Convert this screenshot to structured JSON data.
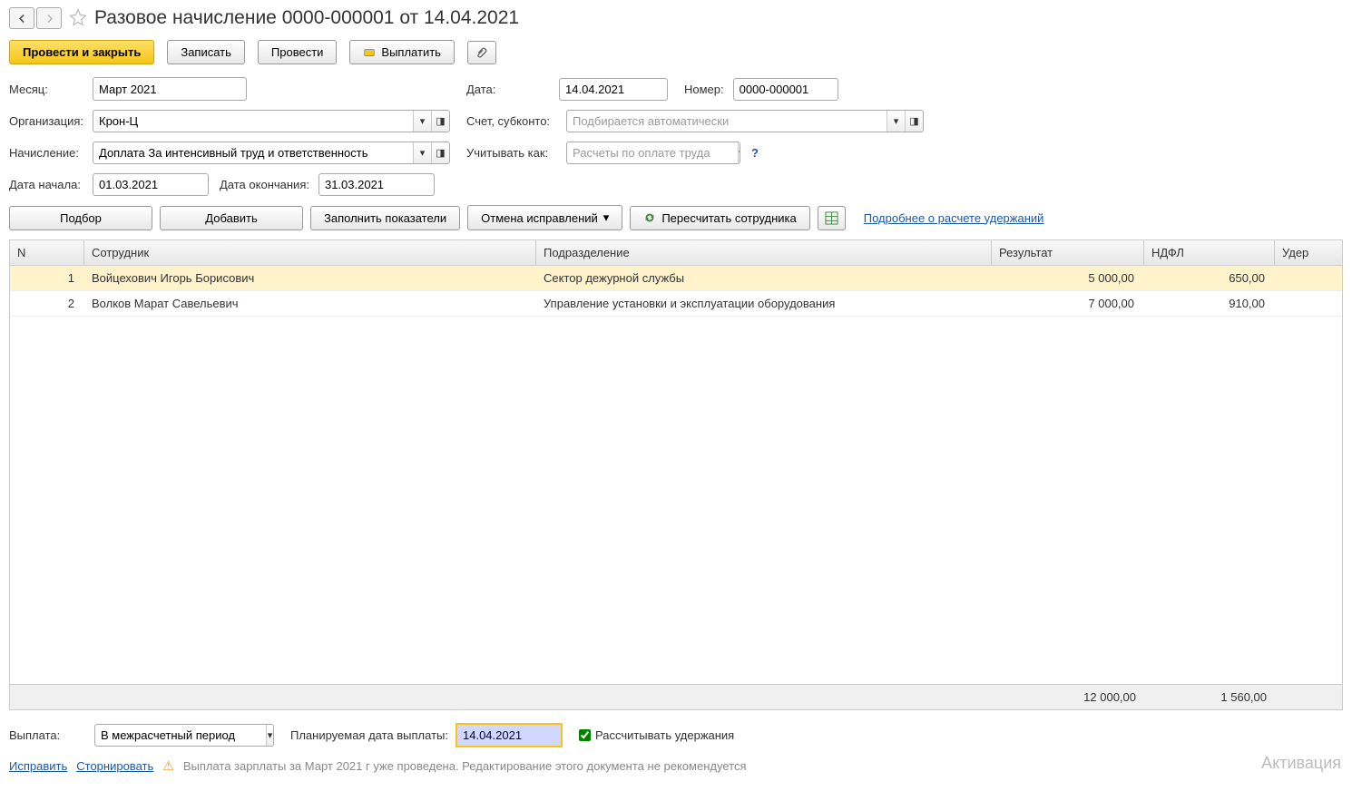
{
  "header": {
    "title": "Разовое начисление 0000-000001 от 14.04.2021"
  },
  "toolbar": {
    "post_and_close": "Провести и закрыть",
    "save": "Записать",
    "post": "Провести",
    "pay": "Выплатить"
  },
  "form": {
    "month_label": "Месяц:",
    "month_value": "Март 2021",
    "date_label": "Дата:",
    "date_value": "14.04.2021",
    "number_label": "Номер:",
    "number_value": "0000-000001",
    "org_label": "Организация:",
    "org_value": "Крон-Ц",
    "account_label": "Счет, субконто:",
    "account_placeholder": "Подбирается автоматически",
    "accrual_label": "Начисление:",
    "accrual_value": "Доплата За интенсивный труд и ответственность",
    "consider_label": "Учитывать как:",
    "consider_placeholder": "Расчеты по оплате труда",
    "start_label": "Дата начала:",
    "start_value": "01.03.2021",
    "end_label": "Дата окончания:",
    "end_value": "31.03.2021"
  },
  "toolbar2": {
    "select": "Подбор",
    "add": "Добавить",
    "fill": "Заполнить показатели",
    "cancel": "Отмена исправлений",
    "recalc": "Пересчитать сотрудника",
    "details_link": "Подробнее о расчете удержаний"
  },
  "table": {
    "columns": {
      "n": "N",
      "emp": "Сотрудник",
      "dept": "Подразделение",
      "res": "Результат",
      "ndfl": "НДФЛ",
      "ud": "Удер"
    },
    "rows": [
      {
        "n": "1",
        "emp": "Войцехович Игорь Борисович",
        "dept": "Сектор дежурной службы",
        "res": "5 000,00",
        "ndfl": "650,00"
      },
      {
        "n": "2",
        "emp": "Волков Марат Савельевич",
        "dept": "Управление установки и эксплуатации оборудования",
        "res": "7 000,00",
        "ndfl": "910,00"
      }
    ],
    "totals": {
      "res": "12 000,00",
      "ndfl": "1 560,00"
    }
  },
  "footer": {
    "payout_label": "Выплата:",
    "payout_value": "В межрасчетный период",
    "plan_date_label": "Планируемая дата выплаты:",
    "plan_date_value": "14.04.2021",
    "calc_ded_label": "Рассчитывать удержания",
    "correct": "Исправить",
    "reverse": "Сторнировать",
    "warning": "Выплата зарплаты за Март 2021 г уже проведена. Редактирование этого документа не рекомендуется",
    "activation": "Активация"
  }
}
